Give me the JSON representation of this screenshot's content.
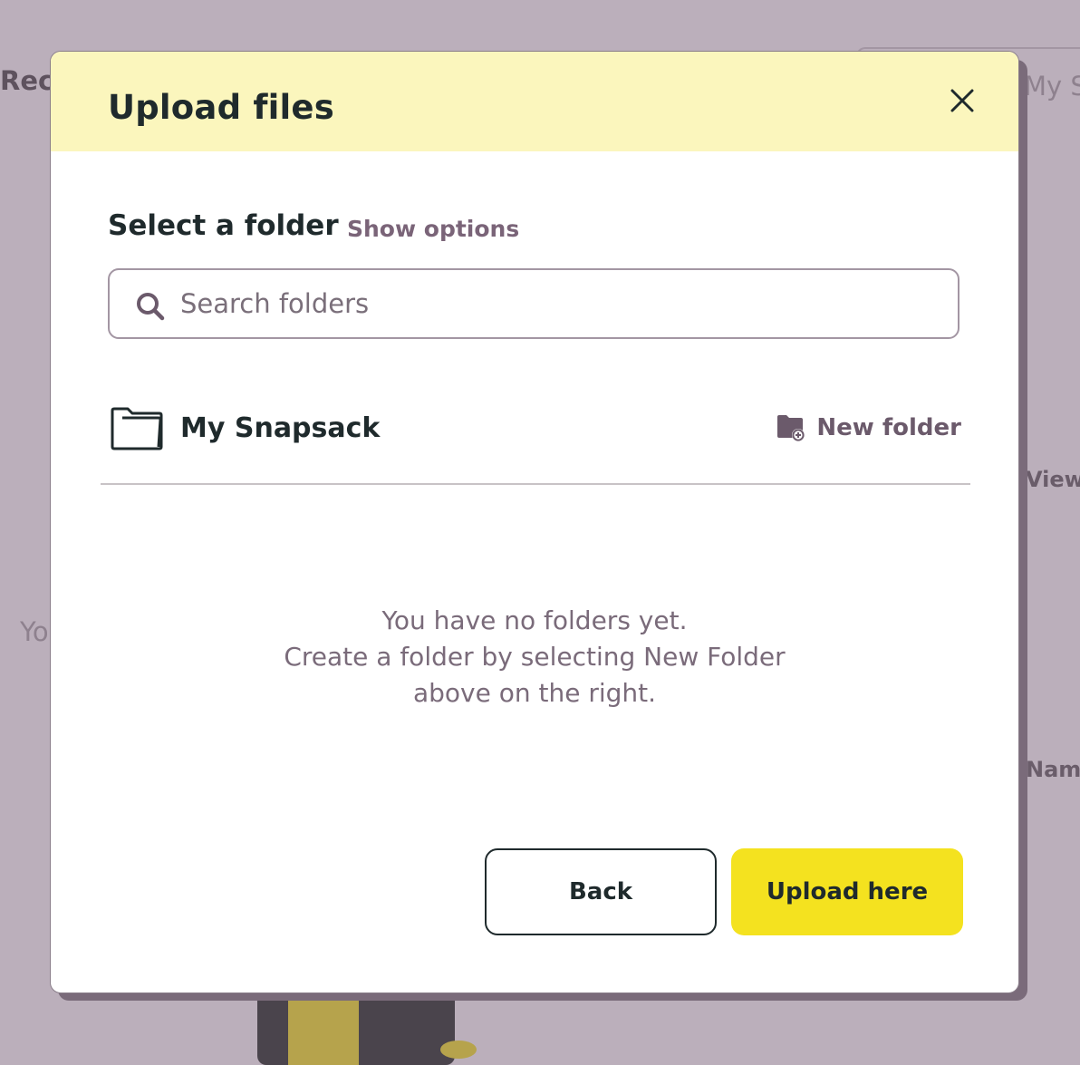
{
  "background": {
    "recent_label": "Recent",
    "tab_label": "My Snapsack",
    "view_label": "View",
    "name_label": "Name",
    "empty_label": "You"
  },
  "modal": {
    "title": "Upload files",
    "close_icon": "close-icon",
    "select_folder_title": "Select a folder",
    "show_options_label": "Show options",
    "search": {
      "placeholder": "Search folders",
      "value": "",
      "icon": "search-icon"
    },
    "root_folder": {
      "name": "My Snapsack",
      "icon": "folder-icon"
    },
    "new_folder": {
      "label": "New folder",
      "icon": "folder-plus-icon"
    },
    "empty_state": {
      "line1": "You have no folders yet.",
      "line2": "Create a folder by selecting New Folder",
      "line3": "above on the right."
    },
    "buttons": {
      "back": "Back",
      "upload": "Upload here"
    }
  },
  "colors": {
    "overlay": "#bbafbb",
    "header_bg": "#fbf6bd",
    "primary_button": "#f4e21f",
    "accent_text": "#7a6478",
    "dark_text": "#1f2a2c"
  }
}
